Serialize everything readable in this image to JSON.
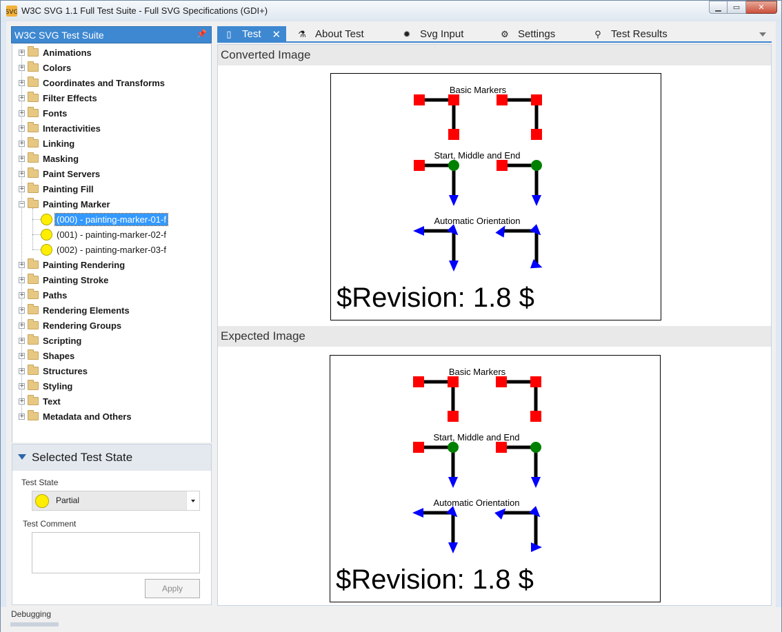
{
  "window": {
    "title": "W3C SVG 1.1 Full Test Suite - Full SVG Specifications (GDI+)",
    "min_glyph": "▁",
    "max_glyph": "▭",
    "close_glyph": "✕"
  },
  "sidebar": {
    "title": "W3C SVG Test Suite",
    "pin_glyph": "📌",
    "categories": [
      "Animations",
      "Colors",
      "Coordinates and Transforms",
      "Filter Effects",
      "Fonts",
      "Interactivities",
      "Linking",
      "Masking",
      "Paint Servers",
      "Painting Fill",
      "Painting Marker",
      "Painting Rendering",
      "Painting Stroke",
      "Paths",
      "Rendering Elements",
      "Rendering Groups",
      "Scripting",
      "Shapes",
      "Structures",
      "Styling",
      "Text",
      "Metadata and Others"
    ],
    "expanded_category": "Painting Marker",
    "tests": [
      "(000) - painting-marker-01-f",
      "(001) - painting-marker-02-f",
      "(002) - painting-marker-03-f"
    ],
    "selected_test_index": 0
  },
  "state_panel": {
    "title": "Selected Test State",
    "test_state_label": "Test State",
    "test_state_value": "Partial",
    "test_state_color": "#ffee00",
    "comment_label": "Test Comment",
    "apply_label": "Apply"
  },
  "tabs": [
    {
      "label": "Test",
      "icon": "document-icon",
      "active": true
    },
    {
      "label": "About Test",
      "icon": "flask-icon",
      "active": false
    },
    {
      "label": "Svg Input",
      "icon": "svg-logo-icon",
      "active": false
    },
    {
      "label": "Settings",
      "icon": "gear-icon",
      "active": false
    },
    {
      "label": "Test Results",
      "icon": "results-icon",
      "active": false
    }
  ],
  "converted": {
    "heading": "Converted Image",
    "labels": {
      "basic": "Basic Markers",
      "sme": "Start, Middle and End",
      "auto": "Automatic Orientation"
    },
    "revision": "$Revision: 1.8 $"
  },
  "expected": {
    "heading": "Expected Image",
    "labels": {
      "basic": "Basic Markers",
      "sme": "Start, Middle and End",
      "auto": "Automatic Orientation"
    },
    "revision": "$Revision: 1.8 $"
  },
  "colors": {
    "accent": "#3e88d1",
    "marker_red": "#ff0000",
    "marker_green": "#008000",
    "marker_blue": "#0000ff"
  },
  "statusbar": {
    "text": "Debugging"
  }
}
